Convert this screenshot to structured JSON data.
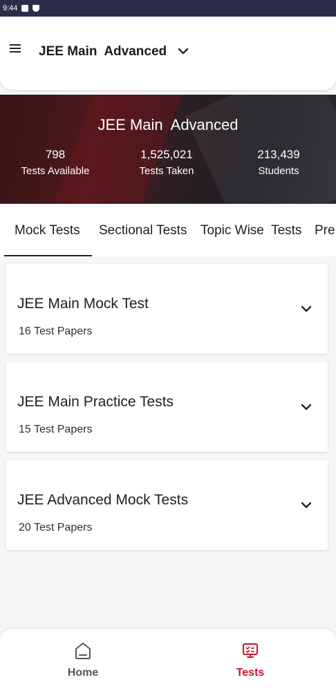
{
  "status_bar": {
    "time": "9:44"
  },
  "app_bar": {
    "title": "JEE Main  Advanced"
  },
  "hero": {
    "title": "JEE Main  Advanced",
    "stats": [
      {
        "value": "798",
        "label": "Tests Available"
      },
      {
        "value": "1,525,021",
        "label": "Tests Taken"
      },
      {
        "value": "213,439",
        "label": "Students"
      }
    ]
  },
  "tabs": [
    {
      "label": "Mock Tests",
      "active": true
    },
    {
      "label": "Sectional Tests"
    },
    {
      "label": "Topic Wise  Tests"
    },
    {
      "label": "Pre"
    }
  ],
  "test_groups": [
    {
      "title": "JEE Main Mock Test",
      "subtitle": "16 Test Papers"
    },
    {
      "title": "JEE Main Practice Tests",
      "subtitle": "15 Test Papers"
    },
    {
      "title": "JEE Advanced Mock Tests",
      "subtitle": "20 Test Papers"
    }
  ],
  "bottom_nav": {
    "items": [
      {
        "label": "Home",
        "icon": "home-icon",
        "active": false
      },
      {
        "label": "Tests",
        "icon": "tests-icon",
        "active": true
      }
    ]
  },
  "colors": {
    "accent": "#c8102e",
    "inactive": "#555555",
    "status_bar": "#2c2c4a"
  }
}
